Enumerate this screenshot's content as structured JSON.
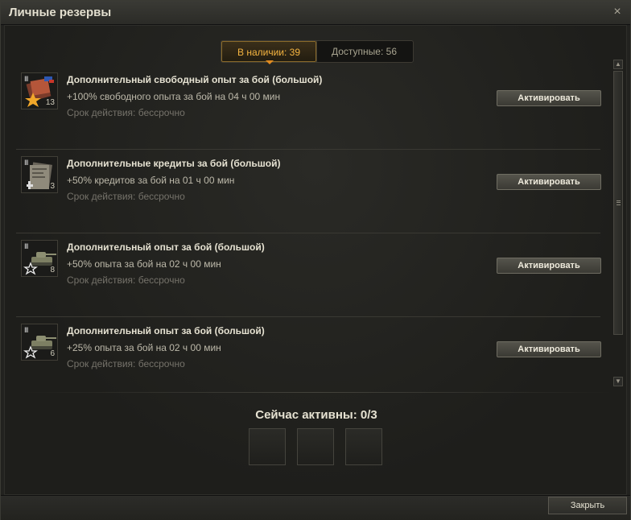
{
  "window": {
    "title": "Личные резервы",
    "close_icon": "×"
  },
  "tabs": [
    {
      "label": "В наличии: 39",
      "active": true
    },
    {
      "label": "Доступные: 56",
      "active": false
    }
  ],
  "reserves": [
    {
      "title": "Дополнительный свободный опыт за бой (большой)",
      "description": "+100% свободного опыта за бой на 04 ч 00 мин",
      "term": "Срок действия: бессрочно",
      "count": "13",
      "level": "III",
      "icon": "free-xp-icon",
      "button_label": "Активировать"
    },
    {
      "title": "Дополнительные кредиты за бой (большой)",
      "description": "+50% кредитов за бой на 01 ч 00 мин",
      "term": "Срок действия: бессрочно",
      "count": "3",
      "level": "III",
      "icon": "credits-icon",
      "button_label": "Активировать"
    },
    {
      "title": "Дополнительный опыт за бой (большой)",
      "description": "+50% опыта за бой на 02 ч 00 мин",
      "term": "Срок действия: бессрочно",
      "count": "8",
      "level": "III",
      "icon": "xp-tank-icon",
      "button_label": "Активировать"
    },
    {
      "title": "Дополнительный опыт за бой (большой)",
      "description": "+25% опыта за бой на 02 ч 00 мин",
      "term": "Срок действия: бессрочно",
      "count": "6",
      "level": "III",
      "icon": "xp-tank-icon",
      "button_label": "Активировать"
    }
  ],
  "active_section": {
    "title": "Сейчас активны: 0/3"
  },
  "footer": {
    "close_label": "Закрыть"
  },
  "colors": {
    "accent": "#f4b440",
    "background": "#22221f",
    "text": "#e6e2d2"
  }
}
